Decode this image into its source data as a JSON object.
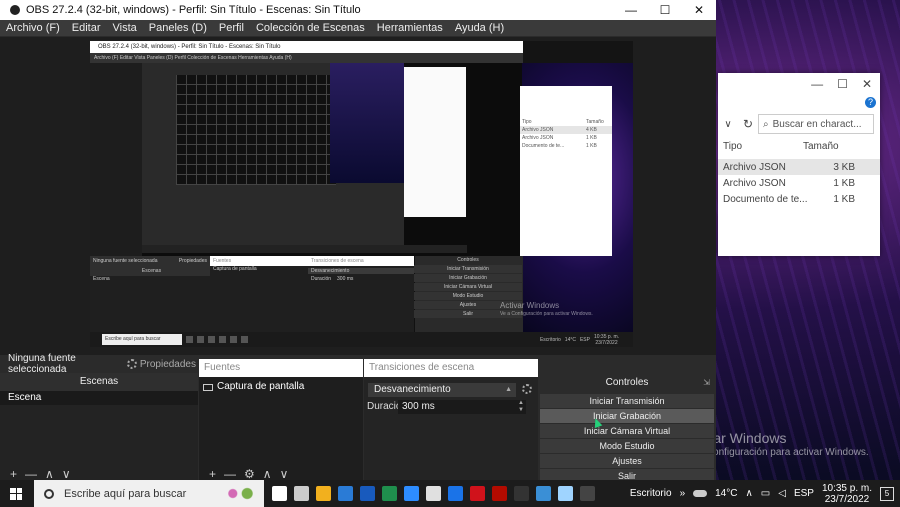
{
  "obs": {
    "title": "OBS 27.2.4 (32-bit, windows) - Perfil: Sin Título - Escenas: Sin Título",
    "window_controls": [
      "—",
      "☐",
      "✕"
    ],
    "menu": [
      "Archivo (F)",
      "Editar",
      "Vista",
      "Paneles (D)",
      "Perfil",
      "Colección de Escenas",
      "Herramientas",
      "Ayuda (H)"
    ]
  },
  "preview": {
    "inner_title": "OBS 27.2.4 (32-bit, windows) - Perfil: Sin Título - Escenas: Sin Título",
    "inner_menu": "Archivo (F)   Editar   Vista   Paneles (D)   Perfil   Colección de Escenas   Herramientas   Ayuda (H)",
    "explorer_cols": [
      "Tipo",
      "Tamaño"
    ],
    "explorer_rows": [
      {
        "type": "Archivo JSON",
        "size": "4 KB"
      },
      {
        "type": "Archivo JSON",
        "size": "1 KB"
      },
      {
        "type": "Documento de te...",
        "size": "1 KB"
      }
    ],
    "docks": {
      "source_info": "Ninguna fuente seleccionada",
      "properties": "Propiedades",
      "scenes": "Escenas",
      "scene_item": "Escena",
      "sources": "Fuentes",
      "source_item": "Captura de pantalla",
      "transitions": "Transiciones de escena",
      "transition_value": "Desvanecimiento",
      "duration_label": "Duración",
      "duration_value": "300 ms",
      "controls": "Controles",
      "buttons": [
        "Iniciar Transmisión",
        "Iniciar Grabación",
        "Iniciar Cámara Virtual",
        "Modo Estudio",
        "Ajustes",
        "Salir"
      ]
    },
    "activate_title": "Activar Windows",
    "activate_sub": "Ve a Configuración para activar Windows.",
    "taskbar_search": "Escribe aquí para buscar",
    "taskbar_desk": "Escritorio",
    "taskbar_temp": "14°C",
    "taskbar_lang": "ESP",
    "taskbar_time": "10:35 p. m.",
    "taskbar_date": "23/7/2022"
  },
  "source_info": {
    "text": "Ninguna fuente seleccionada",
    "properties": "Propiedades"
  },
  "scenes": {
    "title": "Escenas",
    "items": [
      "Escena"
    ],
    "footer": [
      "+",
      "—",
      "∧",
      "∨"
    ]
  },
  "sources": {
    "title": "Fuentes",
    "items": [
      "Captura de pantalla"
    ],
    "footer": [
      "+",
      "—",
      "⚙",
      "∧",
      "∨"
    ]
  },
  "transitions": {
    "title": "Transiciones de escena",
    "selected": "Desvanecimiento",
    "duration_label": "Duración",
    "duration_value": "300 ms"
  },
  "controls": {
    "title": "Controles",
    "pin": "⇲",
    "buttons": [
      "Iniciar Transmisión",
      "Iniciar Grabación",
      "Iniciar Cámara Virtual",
      "Modo Estudio",
      "Ajustes",
      "Salir"
    ]
  },
  "explorer": {
    "controls": [
      "—",
      "☐",
      "✕"
    ],
    "help": "?",
    "chevron": "∨",
    "refresh": "↻",
    "search_placeholder": "Buscar en charact...",
    "cols": [
      "Tipo",
      "Tamaño"
    ],
    "rows": [
      {
        "type": "Archivo JSON",
        "size": "3 KB"
      },
      {
        "type": "Archivo JSON",
        "size": "1 KB"
      },
      {
        "type": "Documento de te...",
        "size": "1 KB"
      }
    ]
  },
  "activate": {
    "title": "Activar Windows",
    "sub": "Ve a Configuración para activar Windows."
  },
  "taskbar": {
    "search": "Escribe aquí para buscar",
    "desktop": "Escritorio",
    "chevron": "»",
    "temp": "14°C",
    "up": "∧",
    "lang": "ESP",
    "time": "10:35 p. m.",
    "date": "23/7/2022",
    "notif": "5",
    "icon_colors": [
      "#ffffff",
      "#cccccc",
      "#f2b01e",
      "#2a7bd6",
      "#185abd",
      "#1f8f4d",
      "#2d8cff",
      "#e0e0e0",
      "#1a73e8",
      "#d0121b",
      "#b30b00",
      "#333333",
      "#3a8fd6",
      "#9fd4ff",
      "#444444"
    ]
  }
}
